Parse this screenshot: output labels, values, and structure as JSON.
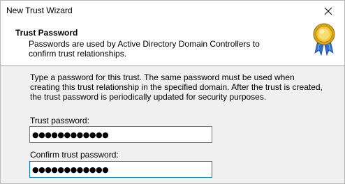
{
  "window": {
    "title": "New Trust Wizard"
  },
  "header": {
    "title": "Trust Password",
    "subtitle": "Passwords are used by Active Directory Domain Controllers to confirm trust relationships."
  },
  "body": {
    "description": "Type a password for this trust. The same password must be used when creating this trust relationship in the specified domain. After the trust is created, the trust password is periodically updated for security purposes."
  },
  "fields": {
    "trust_password_label": "Trust password:",
    "trust_password_value": "●●●●●●●●●●●●",
    "confirm_password_label": "Confirm trust password:",
    "confirm_password_value": "●●●●●●●●●●●●"
  },
  "icons": {
    "close": "close-icon",
    "badge": "award-badge-icon"
  },
  "colors": {
    "focus_border": "#0078d7",
    "badge_gold": "#e8b820",
    "ribbon_blue": "#2e6fd0"
  }
}
